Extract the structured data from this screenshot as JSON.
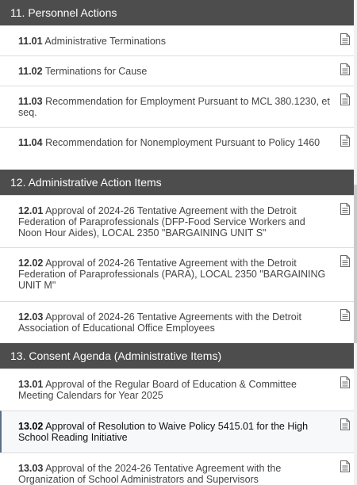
{
  "sections": [
    {
      "header": "11. Personnel Actions",
      "items": [
        {
          "number": "11.01",
          "title": "Administrative Terminations"
        },
        {
          "number": "11.02",
          "title": "Terminations for Cause"
        },
        {
          "number": "11.03",
          "title": "Recommendation for Employment Pursuant to MCL 380.1230, et seq."
        },
        {
          "number": "11.04",
          "title": "Recommendation for Nonemployment Pursuant to Policy 1460"
        }
      ]
    },
    {
      "header": "12. Administrative Action Items",
      "items": [
        {
          "number": "12.01",
          "title": "Approval of 2024-26 Tentative Agreement with the Detroit Federation of Paraprofessionals (DFP-Food Service Workers and Noon Hour Aides), LOCAL 2350 \"BARGAINING UNIT S\""
        },
        {
          "number": "12.02",
          "title": "Approval of 2024-26 Tentative Agreement with the Detroit Federation of Paraprofessionals (PARA), LOCAL 2350 \"BARGAINING UNIT M\""
        },
        {
          "number": "12.03",
          "title": "Approval of 2024-26 Tentative Agreements with the Detroit Association of Educational Office Employees"
        }
      ]
    },
    {
      "header": "13. Consent Agenda (Administrative Items)",
      "items": [
        {
          "number": "13.01",
          "title": "Approval of the Regular Board of Education & Committee Meeting Calendars for Year 2025"
        },
        {
          "number": "13.02",
          "title": "Approval of Resolution to Waive Policy 5415.01 for the High School Reading Initiative"
        },
        {
          "number": "13.03",
          "title": "Approval of the 2024-26 Tentative Agreement with the Organization of School Administrators and Supervisors"
        }
      ]
    }
  ],
  "icons": {
    "attachment": "document-icon"
  },
  "colors": {
    "header_bg": "#4d4d4d",
    "header_text": "#ffffff",
    "selected_accent": "#5b6f86"
  }
}
